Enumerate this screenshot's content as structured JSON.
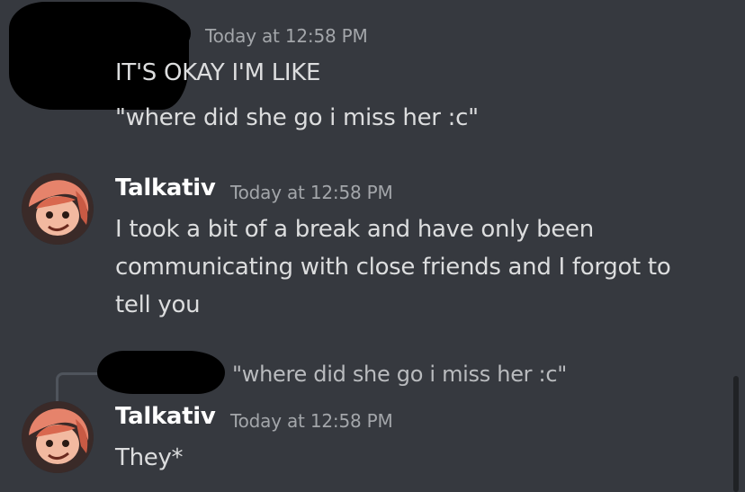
{
  "messages": [
    {
      "author_redacted": true,
      "timestamp": "Today at 12:58 PM",
      "lines": [
        "IT'S OKAY I'M LIKE",
        "\"where did she go i miss her :c\""
      ]
    },
    {
      "author": "Talkativ",
      "timestamp": "Today at 12:58 PM",
      "lines": [
        "I took a bit of a break and have only been",
        "communicating with close friends and I forgot to",
        "tell you"
      ],
      "avatar_icon": "character-avatar"
    },
    {
      "reply_to": {
        "author_redacted": true,
        "text": "\"where did she go i miss her :c\""
      },
      "author": "Talkativ",
      "timestamp": "Today at 12:58 PM",
      "lines": [
        "They*"
      ],
      "avatar_icon": "character-avatar"
    }
  ],
  "colors": {
    "background": "#36393f",
    "text": "#dcddde",
    "author": "#ffffff",
    "timestamp": "#a3a6aa"
  }
}
